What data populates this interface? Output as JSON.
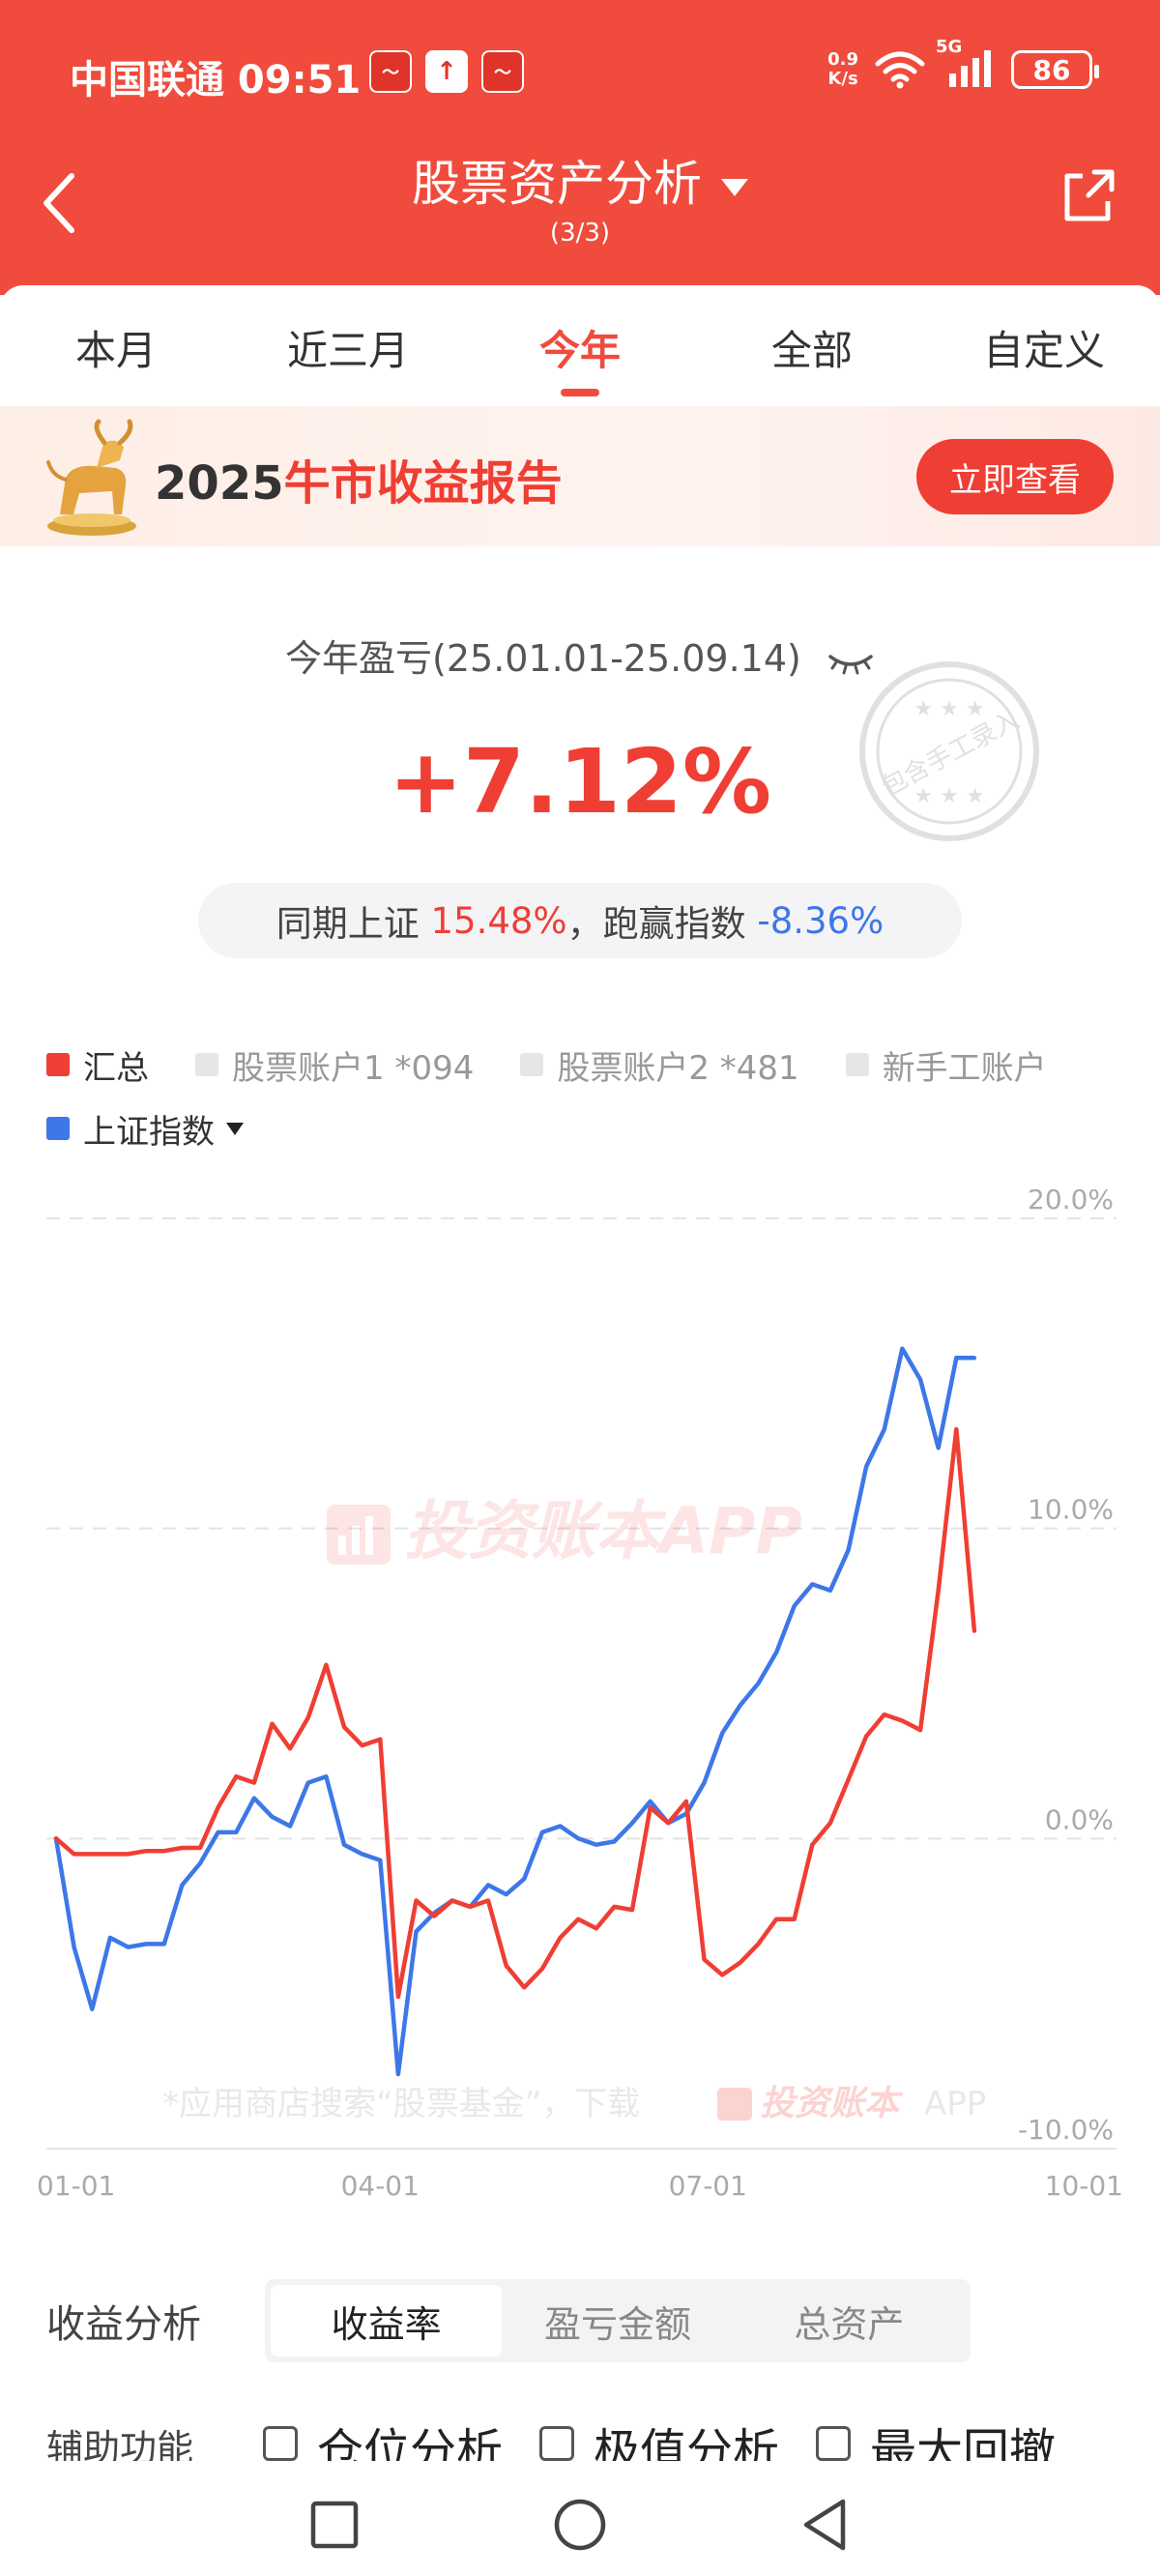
{
  "status_bar": {
    "carrier_time": "中国联通 09:51",
    "net_speed_value": "0.9",
    "net_speed_unit": "K/s",
    "network": "5G",
    "battery": "86"
  },
  "header": {
    "title": "股票资产分析",
    "page_counter": "(3/3)"
  },
  "tabs": [
    {
      "label": "本月"
    },
    {
      "label": "近三月"
    },
    {
      "label": "今年"
    },
    {
      "label": "全部"
    },
    {
      "label": "自定义"
    }
  ],
  "banner": {
    "year": "2025",
    "title": "牛市收益报告",
    "button": "立即查看"
  },
  "summary": {
    "period_label": "今年盈亏(25.01.01-25.09.14)",
    "profit": "+7.12%",
    "compare_label": "同期上证",
    "index_return": "15.48%",
    "separator": "，",
    "beat_label": "跑赢指数",
    "beat_value": "-8.36%",
    "stamp_text": "包含手工录入"
  },
  "legend": {
    "items": [
      {
        "label": "汇总",
        "color": "#ef3e34",
        "active": true
      },
      {
        "label": "股票账户1 *094",
        "color": "#e6e6e6",
        "active": false
      },
      {
        "label": "股票账户2 *481",
        "color": "#e6e6e6",
        "active": false
      },
      {
        "label": "新手工账户",
        "color": "#e6e6e6",
        "active": false
      }
    ],
    "index_item": {
      "label": "上证指数",
      "color": "#3d77e8"
    }
  },
  "chart_data": {
    "type": "line",
    "x_ticks": [
      "01-01",
      "04-01",
      "07-01",
      "10-01"
    ],
    "y_ticks": [
      "20.0%",
      "10.0%",
      "0.0%",
      "-10.0%"
    ],
    "ylim": [
      -10,
      20
    ],
    "xlim": [
      0,
      273
    ],
    "watermark": "投资账本APP",
    "footer_note": "*应用商店搜索“股票基金”，下载",
    "footer_brand": "投资账本",
    "footer_app": "APP",
    "series": [
      {
        "name": "汇总",
        "color": "#ef3e34",
        "x": [
          0,
          5,
          10,
          15,
          20,
          25,
          30,
          35,
          40,
          45,
          50,
          55,
          60,
          65,
          70,
          75,
          80,
          85,
          90,
          95,
          100,
          105,
          110,
          115,
          120,
          125,
          130,
          135,
          140,
          145,
          150,
          155,
          160,
          165,
          170,
          175,
          180,
          185,
          190,
          195,
          200,
          205,
          210,
          215,
          220,
          225,
          230,
          235,
          240,
          245,
          250,
          255
        ],
        "values": [
          0,
          -0.5,
          -0.5,
          -0.5,
          -0.5,
          -0.4,
          -0.4,
          -0.3,
          -0.3,
          1,
          2,
          1.8,
          3.7,
          2.9,
          3.9,
          5.6,
          3.6,
          3,
          3.2,
          -5.1,
          -2,
          -2.5,
          -2,
          -2.2,
          -2,
          -4.1,
          -4.8,
          -4.2,
          -3.2,
          -2.6,
          -2.9,
          -2.2,
          -2.3,
          1,
          0.5,
          1.2,
          -3.9,
          -4.4,
          -4,
          -3.4,
          -2.6,
          -2.6,
          -0.2,
          0.5,
          1.9,
          3.3,
          4,
          3.8,
          3.5,
          8,
          13.2,
          6.7
        ]
      },
      {
        "name": "上证指数",
        "color": "#3d77e8",
        "x": [
          0,
          5,
          10,
          15,
          20,
          25,
          30,
          35,
          40,
          45,
          50,
          55,
          60,
          65,
          70,
          75,
          80,
          85,
          90,
          95,
          100,
          105,
          110,
          115,
          120,
          125,
          130,
          135,
          140,
          145,
          150,
          155,
          160,
          165,
          170,
          175,
          180,
          185,
          190,
          195,
          200,
          205,
          210,
          215,
          220,
          225,
          230,
          235,
          240,
          245,
          250,
          255
        ],
        "values": [
          0,
          -3.5,
          -5.5,
          -3.2,
          -3.5,
          -3.4,
          -3.4,
          -1.5,
          -0.8,
          0.2,
          0.2,
          1.3,
          0.7,
          0.4,
          1.8,
          2,
          -0.2,
          -0.5,
          -0.7,
          -7.6,
          -3,
          -2.4,
          -2,
          -2.2,
          -1.5,
          -1.8,
          -1.3,
          0.2,
          0.4,
          0,
          -0.2,
          -0.1,
          0.5,
          1.2,
          0.5,
          0.8,
          1.8,
          3.4,
          4.3,
          5,
          6,
          7.5,
          8.2,
          8,
          9.3,
          12,
          13.2,
          15.8,
          14.8,
          12.6,
          15.5,
          15.5
        ]
      }
    ]
  },
  "analysis": {
    "label": "收益分析",
    "segments": [
      {
        "label": "收益率",
        "active": true
      },
      {
        "label": "盈亏金额",
        "active": false
      },
      {
        "label": "总资产",
        "active": false
      }
    ]
  },
  "aux": {
    "label": "辅助功能",
    "options": [
      {
        "label": "仓位分析"
      },
      {
        "label": "极值分析"
      },
      {
        "label": "最大回撤"
      }
    ]
  }
}
